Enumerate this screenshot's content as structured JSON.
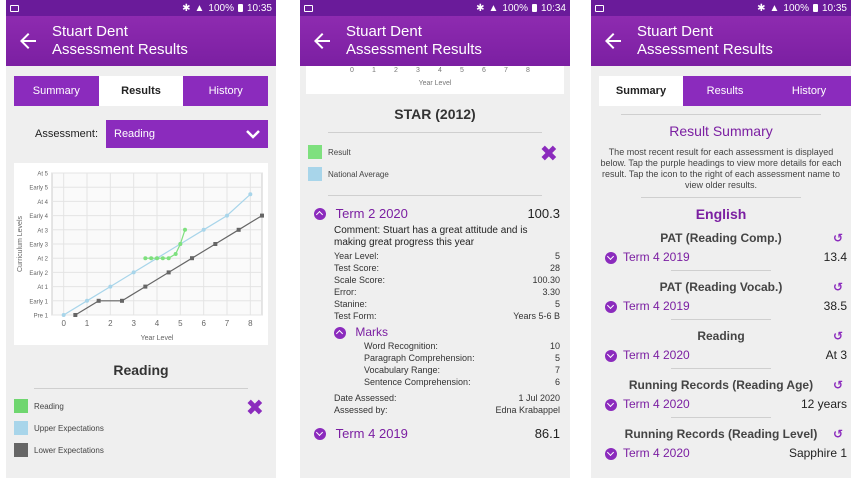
{
  "status": {
    "s1": {
      "battery": "100%",
      "time": "10:35"
    },
    "s2": {
      "battery": "100%",
      "time": "10:34"
    },
    "s3": {
      "battery": "100%",
      "time": "10:35"
    }
  },
  "app": {
    "title": "Stuart Dent",
    "subtitle": "Assessment Results"
  },
  "tabs": [
    "Summary",
    "Results",
    "History"
  ],
  "screen1": {
    "assessment_label": "Assessment:",
    "assessment_value": "Reading",
    "section_title": "Reading",
    "legend": [
      {
        "label": "Reading",
        "color": "#6fd66f"
      },
      {
        "label": "Upper Expectations",
        "color": "#a8d5ea"
      },
      {
        "label": "Lower Expectations",
        "color": "#666666"
      }
    ]
  },
  "chart_data": {
    "type": "line",
    "xlabel": "Year Level",
    "ylabel": "Curriculum Levels",
    "x_ticks": [
      "0",
      "1",
      "2",
      "3",
      "4",
      "5",
      "6",
      "7",
      "8"
    ],
    "y_ticks": [
      "Pre 1",
      "Early 1",
      "At 1",
      "Early 2",
      "At 2",
      "Early 3",
      "At 3",
      "Early 4",
      "At 4",
      "Early 5",
      "At 5"
    ],
    "xlim": [
      -0.5,
      8.5
    ],
    "ylim": [
      0,
      10
    ],
    "grid": true,
    "series": [
      {
        "name": "Reading",
        "color": "#7ee07e",
        "x": [
          3.5,
          3.75,
          4,
          4.25,
          4.5,
          4.8,
          5.0,
          5.2
        ],
        "y": [
          4,
          4,
          4,
          4,
          4,
          4.3,
          5,
          6
        ]
      },
      {
        "name": "Upper Expectations",
        "color": "#a8d5ea",
        "x": [
          0,
          1,
          2,
          3,
          4,
          5,
          6,
          7,
          8
        ],
        "y": [
          0,
          1,
          2,
          3,
          4,
          5,
          6,
          7,
          8.5
        ]
      },
      {
        "name": "Lower Expectations",
        "color": "#666666",
        "x": [
          0.5,
          1.5,
          2.5,
          3.5,
          4.5,
          5.5,
          6.5,
          7.5,
          8.5
        ],
        "y": [
          0,
          1,
          1,
          2,
          3,
          4,
          5,
          6,
          7
        ]
      }
    ]
  },
  "screen2": {
    "axis_ticks": [
      "0",
      "1",
      "2",
      "3",
      "4",
      "5",
      "6",
      "7",
      "8"
    ],
    "axis_label": "Year Level",
    "section_title": "STAR (2012)",
    "legend": [
      {
        "label": "Result",
        "color": "#7ee07e"
      },
      {
        "label": "National Average",
        "color": "#a8d5ea"
      }
    ],
    "entry": {
      "term": "Term 2 2020",
      "score": "100.3",
      "comment": "Comment: Stuart has a great attitude and is making great progress this year",
      "fields": [
        {
          "k": "Year Level:",
          "v": "5"
        },
        {
          "k": "Test Score:",
          "v": "28"
        },
        {
          "k": "Scale Score:",
          "v": "100.30"
        },
        {
          "k": "Error:",
          "v": "3.30"
        },
        {
          "k": "Stanine:",
          "v": "5"
        },
        {
          "k": "Test Form:",
          "v": "Years 5-6 B"
        }
      ],
      "marks_title": "Marks",
      "marks": [
        {
          "k": "Word Recognition:",
          "v": "10"
        },
        {
          "k": "Paragraph Comprehension:",
          "v": "5"
        },
        {
          "k": "Vocabulary Range:",
          "v": "7"
        },
        {
          "k": "Sentence Comprehension:",
          "v": "6"
        }
      ],
      "date_label": "Date Assessed:",
      "date": "1 Jul 2020",
      "by_label": "Assessed by:",
      "by": "Edna Krabappel"
    },
    "next": {
      "term": "Term 4 2019",
      "score": "86.1"
    }
  },
  "screen3": {
    "title": "Result Summary",
    "description": "The most recent result for each assessment is displayed below. Tap the purple headings to view more details for each result. Tap the icon to the right of each assessment name to view older results.",
    "subject": "English",
    "items": [
      {
        "name": "PAT (Reading Comp.)",
        "term": "Term 4 2019",
        "value": "13.4"
      },
      {
        "name": "PAT (Reading Vocab.)",
        "term": "Term 4 2019",
        "value": "38.5"
      },
      {
        "name": "Reading",
        "term": "Term 4 2020",
        "value": "At 3"
      },
      {
        "name": "Running Records (Reading Age)",
        "term": "Term 4 2020",
        "value": "12 years"
      },
      {
        "name": "Running Records (Reading Level)",
        "term": "Term 4 2020",
        "value": "Sapphire 1"
      }
    ]
  }
}
